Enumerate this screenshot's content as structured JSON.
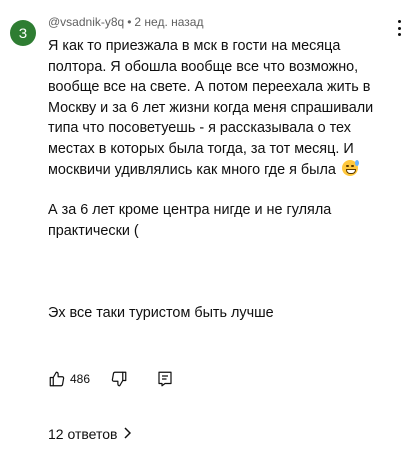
{
  "comment": {
    "avatar_letter": "З",
    "avatar_color": "#2e7d32",
    "author": "@vsadnik-y8q",
    "separator": "•",
    "time_ago": "2 нед. назад",
    "paragraph1": "Я как то приезжала в мск в гости на месяца полтора. Я обошла вообще все что возможно, вообще все на свете. А потом переехала жить в Москву  и за 6 лет жизни когда меня спрашивали типа что посоветуешь - я рассказывала о тех местах в которых была тогда, за тот месяц. И москвичи удивлялись как много где я была",
    "paragraph1_emoji": "grinning-sweat-emoji",
    "paragraph2": "А за 6 лет кроме центра нигде и не гуляла практически (",
    "paragraph3": "Эх все таки туристом быть лучше",
    "like_count": "486",
    "replies_label": "12 ответов",
    "icons": {
      "more": "more-vertical-icon",
      "like": "thumbs-up-icon",
      "dislike": "thumbs-down-icon",
      "reply": "reply-comment-icon",
      "chevron": "chevron-right-icon"
    }
  }
}
